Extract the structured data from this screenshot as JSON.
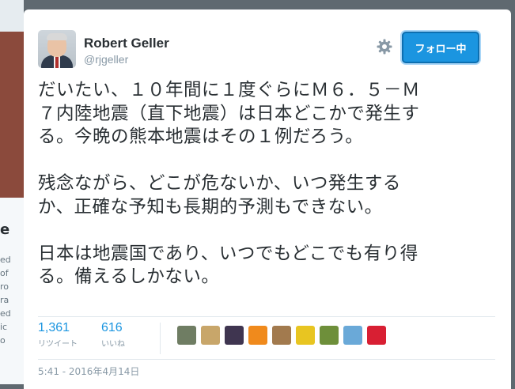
{
  "backdrop": {
    "heading_fragment": "e",
    "text_fragments": [
      "ed",
      "of",
      "ro",
      "ra",
      "ed",
      "ic",
      "o"
    ]
  },
  "tweet": {
    "author": {
      "name": "Robert Geller",
      "handle": "@rjgeller"
    },
    "follow_button_label": "フォロー中",
    "paragraphs": [
      "だいたい、１０年間に１度ぐらにＭ６．５－Ｍ\n７内陸地震（直下地震）は日本どこかで発生す\nる。今晩の熊本地震はその１例だろう。",
      "残念ながら、どこが危ないか、いつ発生する\nか、正確な予知も長期的予測もできない。",
      "日本は地震国であり、いつでもどこでも有り得\nる。備えるしかない。"
    ],
    "stats": {
      "retweets": {
        "count": "1,361",
        "label": "リツイート"
      },
      "likes": {
        "count": "616",
        "label": "いいね"
      }
    },
    "likers": [
      {
        "icon": "liker-avatar-1",
        "color": "#6f7d63"
      },
      {
        "icon": "liker-avatar-2",
        "color": "#c8a66a"
      },
      {
        "icon": "liker-avatar-3",
        "color": "#3f3550"
      },
      {
        "icon": "liker-avatar-4",
        "color": "#f08a1c"
      },
      {
        "icon": "liker-avatar-5",
        "color": "#a27a4e"
      },
      {
        "icon": "liker-avatar-6",
        "color": "#e8c521"
      },
      {
        "icon": "liker-avatar-7",
        "color": "#6e8f3a"
      },
      {
        "icon": "liker-avatar-8",
        "color": "#6aa9d8"
      },
      {
        "icon": "liker-avatar-9",
        "color": "#d81f33"
      }
    ],
    "timestamp": "5:41 - 2016年4月14日"
  },
  "colors": {
    "accent": "#1b95e0",
    "text": "#292f33",
    "muted": "#8899a6"
  }
}
